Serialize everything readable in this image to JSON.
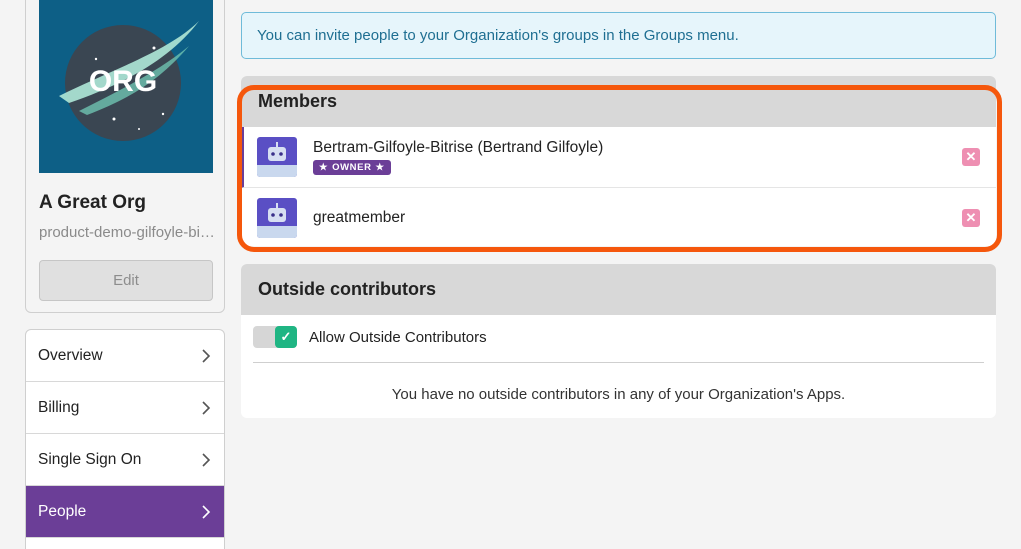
{
  "org": {
    "logo_text": "ORG",
    "name": "A Great Org",
    "slug": "product-demo-gilfoyle-bitrise",
    "edit_label": "Edit"
  },
  "nav": {
    "items": [
      {
        "label": "Overview",
        "active": false
      },
      {
        "label": "Billing",
        "active": false
      },
      {
        "label": "Single Sign On",
        "active": false
      },
      {
        "label": "People",
        "active": true
      }
    ]
  },
  "banner": {
    "text": "You can invite people to your Organization's groups in the Groups menu."
  },
  "members": {
    "title": "Members",
    "rows": [
      {
        "name": "Bertram-Gilfoyle-Bitrise (Bertrand Gilfoyle)",
        "badge": "OWNER",
        "remove_icon": "close-icon"
      },
      {
        "name": "greatmember",
        "badge": "",
        "remove_icon": "close-icon"
      }
    ]
  },
  "outside": {
    "title": "Outside contributors",
    "toggle_label": "Allow Outside Contributors",
    "toggle_on": true,
    "empty_text": "You have no outside contributors in any of your Organization's Apps."
  },
  "colors": {
    "accent_purple": "#6b3e97",
    "highlight_orange": "#f5570c",
    "toggle_green": "#1fb583",
    "remove_pink": "#ee8fb2",
    "logo_bg": "#0d5f86"
  }
}
